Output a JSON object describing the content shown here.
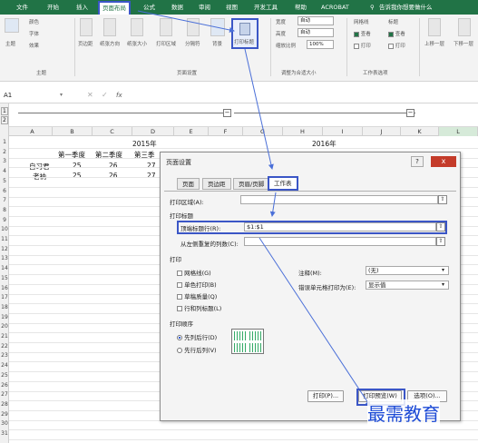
{
  "tabs": [
    "文件",
    "开始",
    "插入",
    "页面布局",
    "公式",
    "数据",
    "审阅",
    "视图",
    "开发工具",
    "帮助",
    "ACROBAT",
    "告诉我你想要做什么"
  ],
  "ribbon": {
    "theme_group": "主题",
    "page_setup_group": "页面设置",
    "fit_group": "调整为合适大小",
    "sheet_options_group": "工作表选项",
    "theme_btn": "主题",
    "colors": "颜色",
    "fonts": "字体",
    "effects": "效果",
    "margins": "页边距",
    "orientation": "纸张方向",
    "size": "纸张大小",
    "print_area": "打印区域",
    "breaks": "分隔符",
    "background": "背景",
    "print_titles": "打印标题",
    "width_label": "宽度",
    "width_val": "自动",
    "height_label": "高度",
    "height_val": "自动",
    "scale_label": "缩放比例",
    "scale_val": "100%",
    "gridlines": "网格线",
    "headings": "标题",
    "view": "查看",
    "print": "打印",
    "bring_forward": "上移一层",
    "send_back": "下移一层"
  },
  "formula_bar": {
    "cell_ref": "A1",
    "fx": "fx"
  },
  "columns": [
    "A",
    "B",
    "C",
    "D",
    "E",
    "F",
    "G",
    "H",
    "I",
    "J",
    "K",
    "L"
  ],
  "rows": [
    "1",
    "2",
    "3",
    "4",
    "5",
    "6",
    "7",
    "8",
    "9",
    "10",
    "11",
    "12",
    "13",
    "14",
    "15",
    "16",
    "17",
    "18",
    "19",
    "20",
    "21",
    "22",
    "23",
    "24",
    "25",
    "26",
    "27",
    "28",
    "29",
    "30",
    "31"
  ],
  "sheet": {
    "year1": "2015年",
    "year2": "2016年",
    "h_q1": "第一季度",
    "h_q2": "第二季度",
    "h_q3": "第三季",
    "r1_name": "自习君",
    "r1_v1": "25",
    "r1_v2": "26",
    "r1_v3": "27",
    "r2_name": "老衲",
    "r2_v1": "25",
    "r2_v2": "26",
    "r2_v3": "27"
  },
  "dialog": {
    "title": "页面设置",
    "close": "x",
    "help": "?",
    "tabs": [
      "页面",
      "页边距",
      "页眉/页脚",
      "工作表"
    ],
    "print_area_label": "打印区域(A):",
    "print_titles_label": "打印标题",
    "rows_repeat_label": "顶端标题行(R):",
    "rows_repeat_value": "$1:$1",
    "cols_repeat_label": "从左侧重复的列数(C):",
    "print_label": "打印",
    "gridlines": "网格线(G)",
    "mono": "单色打印(B)",
    "draft": "草稿质量(Q)",
    "rowcol": "行和列标题(L)",
    "comments_label": "注释(M):",
    "comments_value": "(无)",
    "errors_label": "错误单元格打印为(E):",
    "errors_value": "显示值",
    "order_label": "打印顺序",
    "down_then_over": "先列后行(D)",
    "over_then_down": "先行后列(V)",
    "btn_print": "打印(P)...",
    "btn_preview": "打印预览(W)",
    "btn_options": "选项(O)..."
  },
  "watermark": "最需教育",
  "colors": {
    "excel_green": "#217346",
    "highlight": "#3b56c6",
    "arrow": "#4a6fd8"
  }
}
